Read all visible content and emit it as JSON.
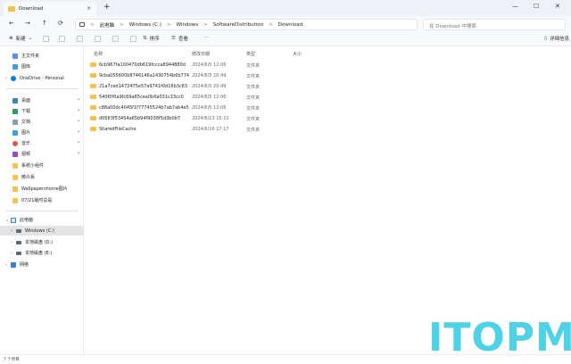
{
  "window": {
    "tab_title": "Download",
    "tab_close": "×",
    "new_tab": "+",
    "controls": {
      "minimize": "—",
      "maximize": "☐",
      "close": "✕"
    }
  },
  "address": {
    "back": "←",
    "forward": "→",
    "up": "↑",
    "refresh": "⟳",
    "crumbs": [
      "此电脑",
      "Windows (C:)",
      "Windows",
      "SoftwareDistribution",
      "Download"
    ],
    "separator": ">",
    "search_placeholder": "在 Download 中搜索"
  },
  "toolbar": {
    "new_label": "新建",
    "sort_label": "排序",
    "view_label": "查看",
    "more_label": "···",
    "details_label": "详细信息"
  },
  "sidebar": {
    "items": [
      {
        "label": "主文件夹",
        "icon": "home-icon"
      },
      {
        "label": "图库",
        "icon": "gallery-icon"
      },
      {
        "label": "OneDrive - Personal",
        "icon": "cloud-icon"
      },
      {
        "label": "桌面",
        "icon": "desktop-icon",
        "pinned": true
      },
      {
        "label": "下载",
        "icon": "download-icon",
        "pinned": true
      },
      {
        "label": "文档",
        "icon": "document-icon",
        "pinned": true
      },
      {
        "label": "图片",
        "icon": "picture-icon",
        "pinned": true
      },
      {
        "label": "音乐",
        "icon": "music-icon",
        "pinned": true
      },
      {
        "label": "视频",
        "icon": "video-icon",
        "pinned": true
      },
      {
        "label": "系统小组件",
        "icon": "folder-icon"
      },
      {
        "label": "微众系",
        "icon": "folder-icon"
      },
      {
        "label": "Wallpapershome图片",
        "icon": "folder-icon"
      },
      {
        "label": "07/21版时总是",
        "icon": "folder-icon"
      }
    ],
    "tree": [
      {
        "label": "此电脑",
        "icon": "pc-icon"
      },
      {
        "label": "Windows (C:)",
        "icon": "drive-icon"
      },
      {
        "label": "本地磁盘 (D:)",
        "icon": "drive-icon"
      },
      {
        "label": "本地磁盘 (E:)",
        "icon": "drive-icon"
      },
      {
        "label": "网络",
        "icon": "network-icon"
      }
    ],
    "pin_glyph": "✦"
  },
  "list": {
    "headers": {
      "name": "名称",
      "date": "修改日期",
      "type": "类型",
      "size": "大小"
    },
    "rows": [
      {
        "name": "6cb967fa100470db619fccca8944880d",
        "date": "2024/6/5 12:06",
        "type": "文件夹"
      },
      {
        "name": "9cba055600b8746146a1430754b6b774",
        "date": "2024/6/5 20:49",
        "type": "文件夹"
      },
      {
        "name": "21a7ced1472475e57a9741f0d16b3c83",
        "date": "2024/6/5 20:49",
        "type": "文件夹"
      },
      {
        "name": "540f0f0a9fc69a65cea0b6a031c13cc0",
        "date": "2024/6/5 12:06",
        "type": "文件夹"
      },
      {
        "name": "c88a00dc4045f1f77745524b7ab7ab4e5",
        "date": "2024/6/5 12:06",
        "type": "文件夹"
      },
      {
        "name": "d0583f53454a65b94f9038f5d3b0b7",
        "date": "2024/6/13 15:11",
        "type": "文件夹"
      },
      {
        "name": "SharedFileCache",
        "date": "2024/6/16 17:17",
        "type": "文件夹"
      }
    ]
  },
  "status": {
    "text": "7 个项目"
  },
  "watermark": "ITOPM",
  "colors": {
    "folder": "#f4c24e",
    "accent": "#0067c0",
    "watermark": "#4fd1e6"
  }
}
